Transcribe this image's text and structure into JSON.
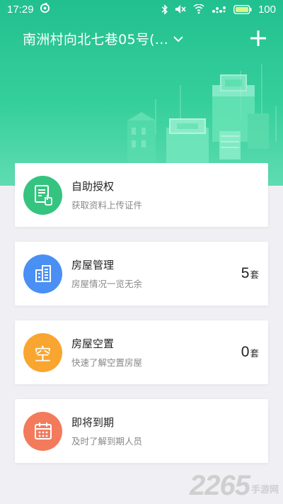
{
  "status_bar": {
    "time": "17:29",
    "battery": "100"
  },
  "header": {
    "address": "南洲村向北七巷05号(...",
    "add_icon": "plus-icon"
  },
  "colors": {
    "hero": "#2cc596",
    "authorize": "#35c47f",
    "house_manage": "#4a8ff3",
    "vacancy": "#f8a630",
    "expiring": "#f47a5c"
  },
  "cards": [
    {
      "title": "自助授权",
      "subtitle": "获取资料上传证件",
      "icon": "document-hand-icon"
    },
    {
      "title": "房屋管理",
      "subtitle": "房屋情况一览无余",
      "icon": "building-icon",
      "count": "5",
      "unit": "套"
    },
    {
      "title": "房屋空置",
      "subtitle": "快速了解空置房屋",
      "icon": "vacant-char-icon",
      "icon_text": "空",
      "count": "0",
      "unit": "套"
    },
    {
      "title": "即将到期",
      "subtitle": "及时了解到期人员",
      "icon": "calendar-icon"
    }
  ],
  "watermark": {
    "number": "2265",
    "site": "手游网"
  }
}
